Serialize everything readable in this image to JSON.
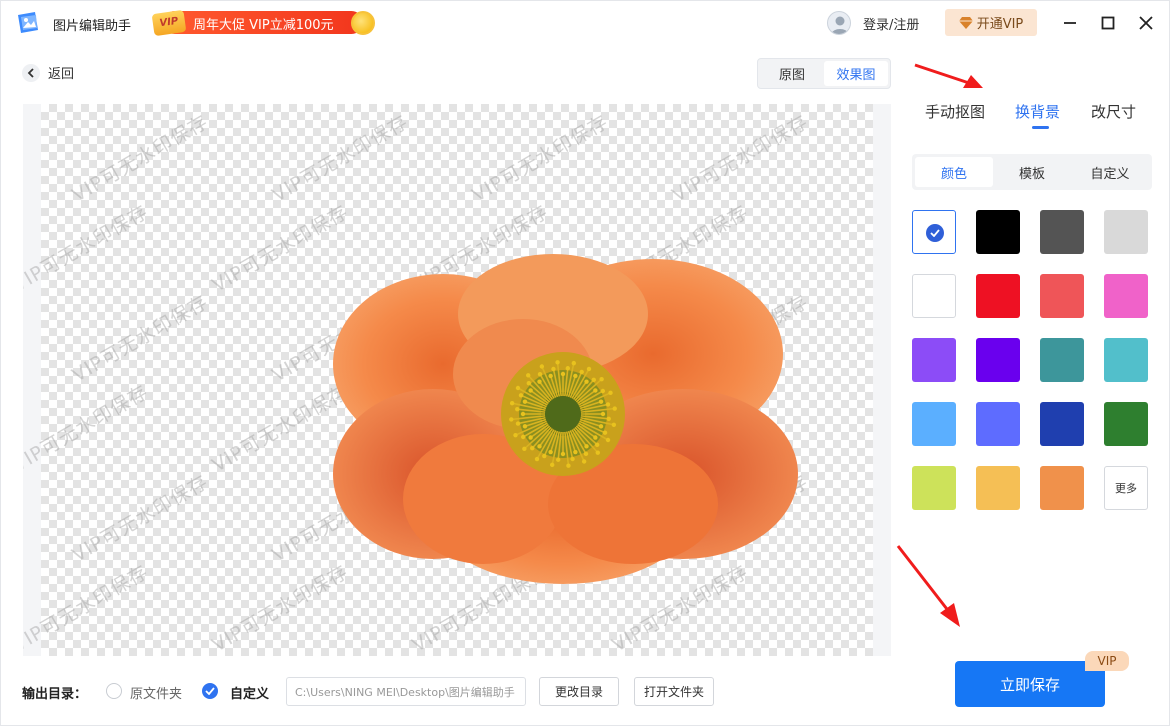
{
  "app": {
    "title": "图片编辑助手",
    "promo_text": "周年大促 VIP立减100元",
    "promo_badge": "VIP",
    "login": "登录/注册",
    "vip_button": "开通VIP"
  },
  "nav": {
    "back": "返回",
    "view_original": "原图",
    "view_result": "效果图",
    "active_view": "效果图"
  },
  "canvas": {
    "watermark": "VIP可无水印保存"
  },
  "panel": {
    "tabs": [
      {
        "label": "手动抠图",
        "active": false
      },
      {
        "label": "换背景",
        "active": true
      },
      {
        "label": "改尺寸",
        "active": false
      }
    ],
    "subtabs": [
      {
        "label": "颜色",
        "active": true
      },
      {
        "label": "模板",
        "active": false
      },
      {
        "label": "自定义",
        "active": false
      }
    ],
    "colors": [
      {
        "hex": "#ffffff",
        "note": "transparent-selected",
        "selected": true
      },
      {
        "hex": "#000000"
      },
      {
        "hex": "#545454"
      },
      {
        "hex": "#d9d9d9"
      },
      {
        "hex": "#ffffff"
      },
      {
        "hex": "#ee1123"
      },
      {
        "hex": "#ef5558"
      },
      {
        "hex": "#f062c9"
      },
      {
        "hex": "#8c4cf7"
      },
      {
        "hex": "#6a00ee"
      },
      {
        "hex": "#3d969b"
      },
      {
        "hex": "#52bfcb"
      },
      {
        "hex": "#5bafff"
      },
      {
        "hex": "#5e6cff"
      },
      {
        "hex": "#1f3faf"
      },
      {
        "hex": "#2e7f2f"
      },
      {
        "hex": "#cde25a"
      },
      {
        "hex": "#f5bf55"
      },
      {
        "hex": "#f0914b"
      }
    ],
    "more": "更多"
  },
  "bottom": {
    "output_label": "输出目录：",
    "option_original": "原文件夹",
    "option_custom": "自定义",
    "path": "C:\\Users\\NING MEI\\Desktop\\图片编辑助手",
    "change_dir": "更改目录",
    "open_folder": "打开文件夹",
    "save": "立即保存",
    "save_badge": "VIP"
  }
}
